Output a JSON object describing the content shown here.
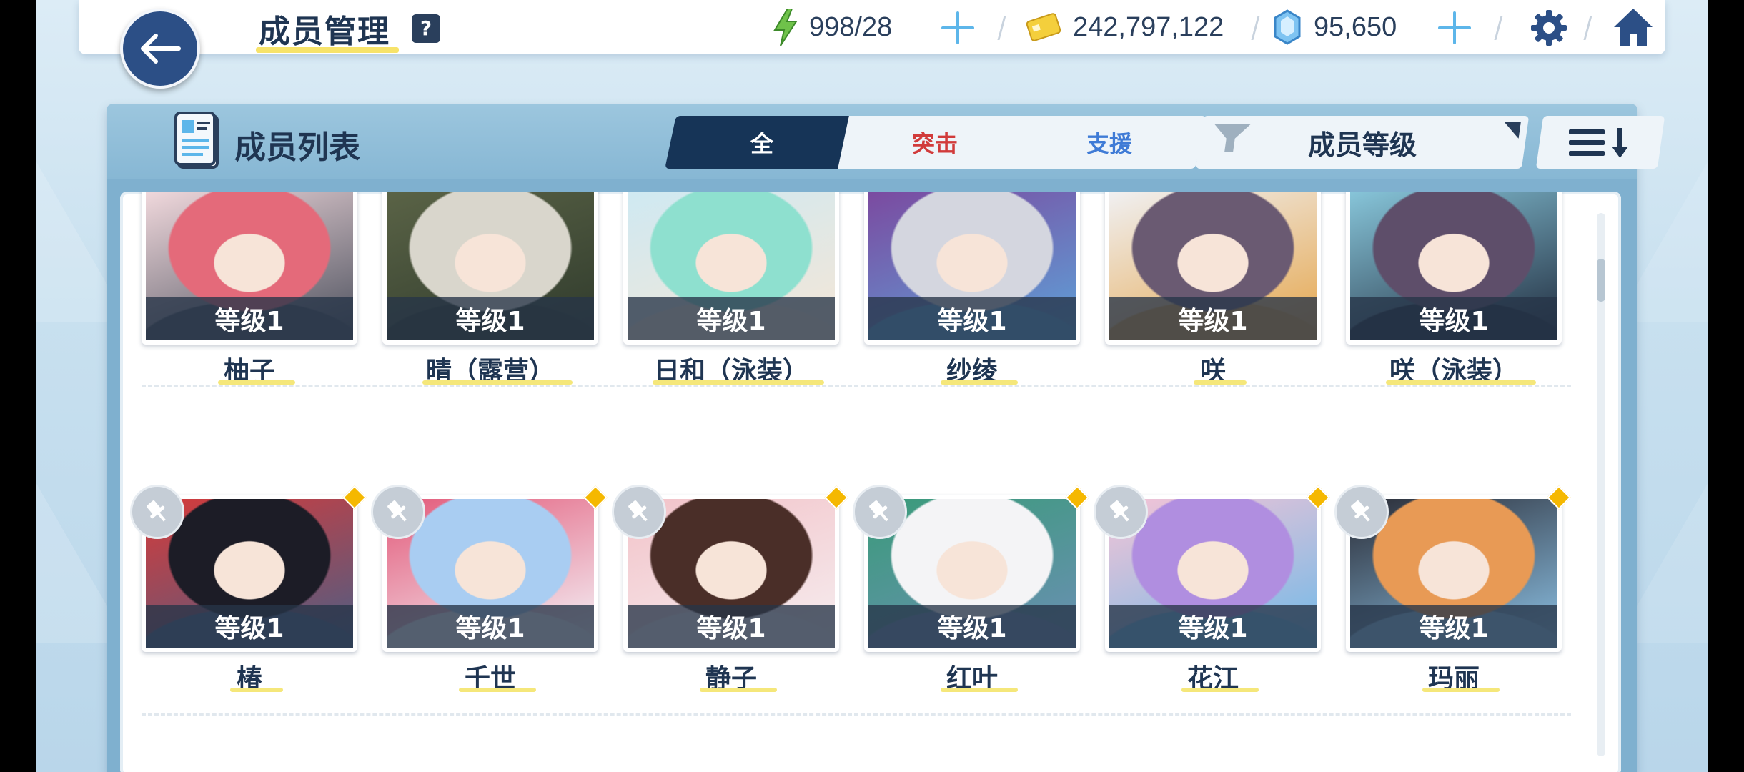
{
  "header": {
    "title": "成员管理",
    "help_label": "?"
  },
  "resources": {
    "ap": "998/28",
    "credits": "242,797,122",
    "pyroxene": "95,650"
  },
  "panel": {
    "title": "成员列表",
    "tabs": [
      {
        "label": "全",
        "active": true
      },
      {
        "label": "突击",
        "active": false
      },
      {
        "label": "支援",
        "active": false
      }
    ],
    "sort_label": "成员等级"
  },
  "rows": [
    {
      "cards": [
        {
          "name": "柚子",
          "level": "等级1",
          "colors": [
            "#e46a7a",
            "#f0d8dc",
            "#4a4f5c"
          ]
        },
        {
          "name": "晴（露营）",
          "level": "等级1",
          "colors": [
            "#d9d6cc",
            "#5a6346",
            "#2f3a2c"
          ]
        },
        {
          "name": "日和（泳装）",
          "level": "等级1",
          "colors": [
            "#8ee0cf",
            "#cfe9f2",
            "#f5e6d6"
          ]
        },
        {
          "name": "纱绫",
          "level": "等级1",
          "colors": [
            "#d4d6df",
            "#7b4aa0",
            "#5da3d9"
          ]
        },
        {
          "name": "咲",
          "level": "等级1",
          "colors": [
            "#6a5a72",
            "#f0f0f2",
            "#e5a54a"
          ]
        },
        {
          "name": "咲（泳装）",
          "level": "等级1",
          "colors": [
            "#5e4e6a",
            "#87c5d9",
            "#1f2a3c"
          ]
        }
      ]
    },
    {
      "cards": [
        {
          "name": "椿",
          "level": "等级1",
          "colors": [
            "#1c1c26",
            "#d63a3a",
            "#4a5f86"
          ]
        },
        {
          "name": "千世",
          "level": "等级1",
          "colors": [
            "#a9cdf2",
            "#e35a7a",
            "#f4f7fb"
          ]
        },
        {
          "name": "静子",
          "level": "等级1",
          "colors": [
            "#4a2e28",
            "#f2c3c9",
            "#f6eef0"
          ]
        },
        {
          "name": "红叶",
          "level": "等级1",
          "colors": [
            "#f4f4f6",
            "#3a9b7a",
            "#6c8fb5"
          ]
        },
        {
          "name": "花江",
          "level": "等级1",
          "colors": [
            "#b08ee0",
            "#f5c4d6",
            "#6fb9e8"
          ]
        },
        {
          "name": "玛丽",
          "level": "等级1",
          "colors": [
            "#e89a55",
            "#2a2c36",
            "#8ec4e8"
          ]
        }
      ]
    }
  ]
}
